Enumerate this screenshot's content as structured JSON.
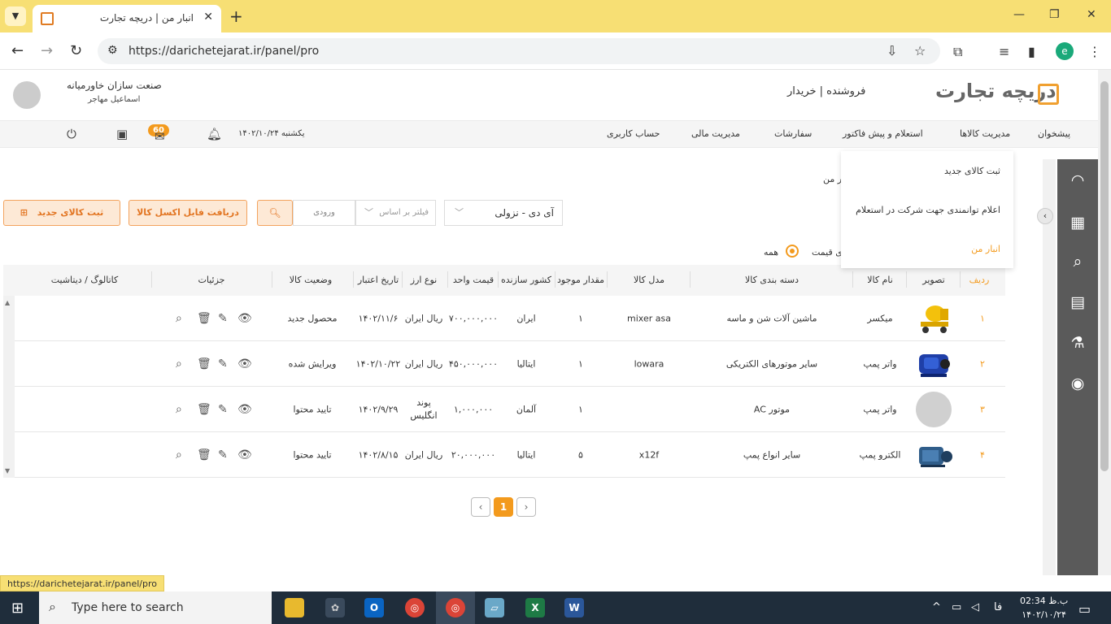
{
  "browser": {
    "tab_title": "انبار من | دریچه تجارت",
    "tab_close": "✕",
    "new_tab": "+",
    "url": "https://darichetejarat.ir/panel/pro"
  },
  "header": {
    "company_name": "صنعت سازان خاورمیانه",
    "user_name": "اسماعیل مهاجر",
    "roles": "فروشنده | خریدار",
    "logo_text": "دریچه تجارت"
  },
  "menu": {
    "items": [
      "پیشخوان",
      "مدیریت کالاها",
      "استعلام و پیش فاکتور",
      "سفارشات",
      "مدیریت مالی",
      "حساب کاربری"
    ],
    "date": "یکشنبه ۱۴۰۲/۱۰/۲۴",
    "badge": "60"
  },
  "dropdown": {
    "items": [
      "ثبت کالای جدید",
      "اعلام توانمندی جهت شرکت در استعلام",
      "انبار من"
    ]
  },
  "breadcrumb_fragment": "ر من",
  "toolbar": {
    "new_product": "ثبت کالای جدید",
    "excel": "دریافت فایل اکسل کالا",
    "search_placeholder": "ورودی",
    "filter_placeholder": "فیلتر بر اساس",
    "sort_value": "آی دی - نزولی"
  },
  "radio": {
    "all": "همه",
    "price_fragment": "ی قیمت"
  },
  "table": {
    "headers": [
      "ردیف",
      "تصویر",
      "نام کالا",
      "دسته بندی کالا",
      "مدل کالا",
      "مقدار موجود",
      "کشور سازنده",
      "قیمت واحد",
      "نوع ارز",
      "تاریخ اعتبار",
      "وضعیت کالا",
      "جزئیات",
      "کاتالوگ / دیتاشیت"
    ],
    "rows": [
      {
        "index": "۱",
        "name": "میکسر",
        "category": "ماشین آلات شن و ماسه",
        "model": "mixer asa",
        "qty": "۱",
        "country": "ایران",
        "price": "۷۰۰,۰۰۰,۰۰۰",
        "currency": "ریال ایران",
        "expiry": "۱۴۰۲/۱۱/۶",
        "status": "محصول جدید",
        "image": "mixer"
      },
      {
        "index": "۲",
        "name": "واتر پمپ",
        "category": "سایر موتورهای الکتریکی",
        "model": "lowara",
        "qty": "۱",
        "country": "ایتالیا",
        "price": "۴۵۰,۰۰۰,۰۰۰",
        "currency": "ریال ایران",
        "expiry": "۱۴۰۲/۱۰/۲۲",
        "status": "ویرایش شده",
        "image": "pump-blue"
      },
      {
        "index": "۳",
        "name": "واتر پمپ",
        "category": "موتور AC",
        "model": "",
        "qty": "۱",
        "country": "آلمان",
        "price": "۱,۰۰۰,۰۰۰",
        "currency": "پوند انگلیس",
        "expiry": "۱۴۰۲/۹/۲۹",
        "status": "تایید محتوا",
        "image": "placeholder"
      },
      {
        "index": "۴",
        "name": "الکترو پمپ",
        "category": "سایر انواع پمپ",
        "model": "x12f",
        "qty": "۵",
        "country": "ایتالیا",
        "price": "۲۰,۰۰۰,۰۰۰",
        "currency": "ریال ایران",
        "expiry": "۱۴۰۲/۸/۱۵",
        "status": "تایید محتوا",
        "image": "electro-pump"
      }
    ]
  },
  "pagination": {
    "current": "1"
  },
  "status_bar_url": "https://darichetejarat.ir/panel/pro",
  "taskbar": {
    "search_placeholder": "Type here to search",
    "lang": "فا",
    "time": "ب.ظ 02:34",
    "date": "۱۴۰۲/۱۰/۲۴"
  },
  "colors": {
    "accent": "#f39a1d",
    "sidebar": "#5a5a5a",
    "tabbar": "#f7df74"
  }
}
